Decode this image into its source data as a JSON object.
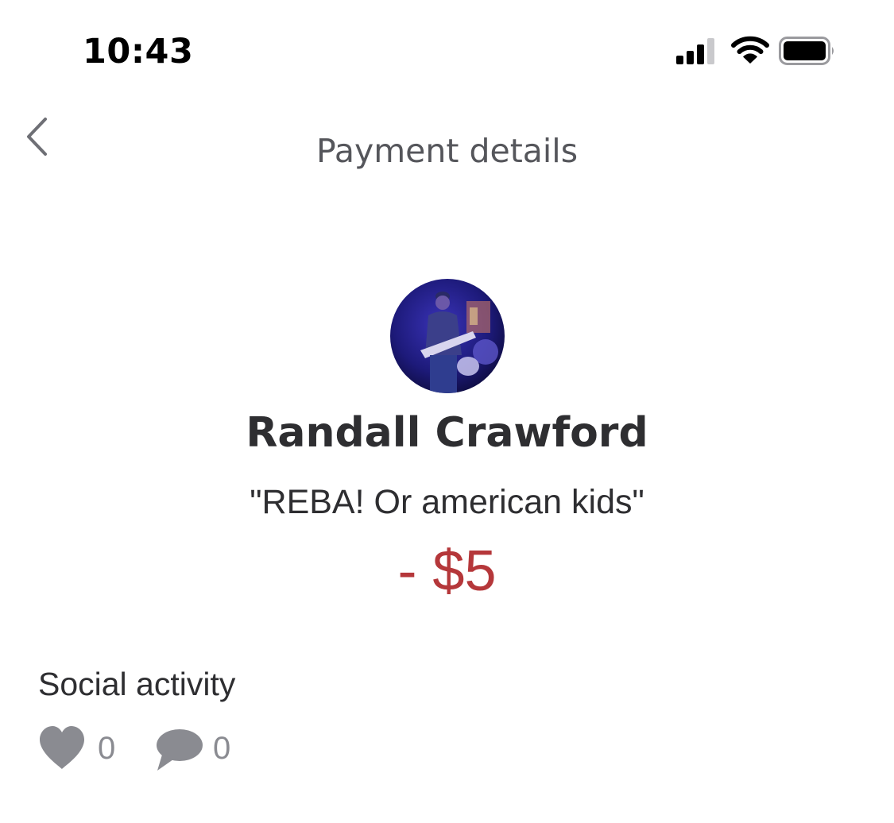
{
  "status_bar": {
    "time": "10:43",
    "icons": [
      "signal-icon",
      "wifi-icon",
      "battery-icon"
    ]
  },
  "nav": {
    "back_icon": "chevron-left-icon",
    "title": "Payment details"
  },
  "payment": {
    "recipient_name": "Randall Crawford",
    "note": "\"REBA! Or american kids\"",
    "amount": "- $5",
    "amount_color": "#b5373a"
  },
  "social": {
    "title": "Social activity",
    "likes": "0",
    "comments": "0",
    "icon_color": "#8a8b91"
  }
}
